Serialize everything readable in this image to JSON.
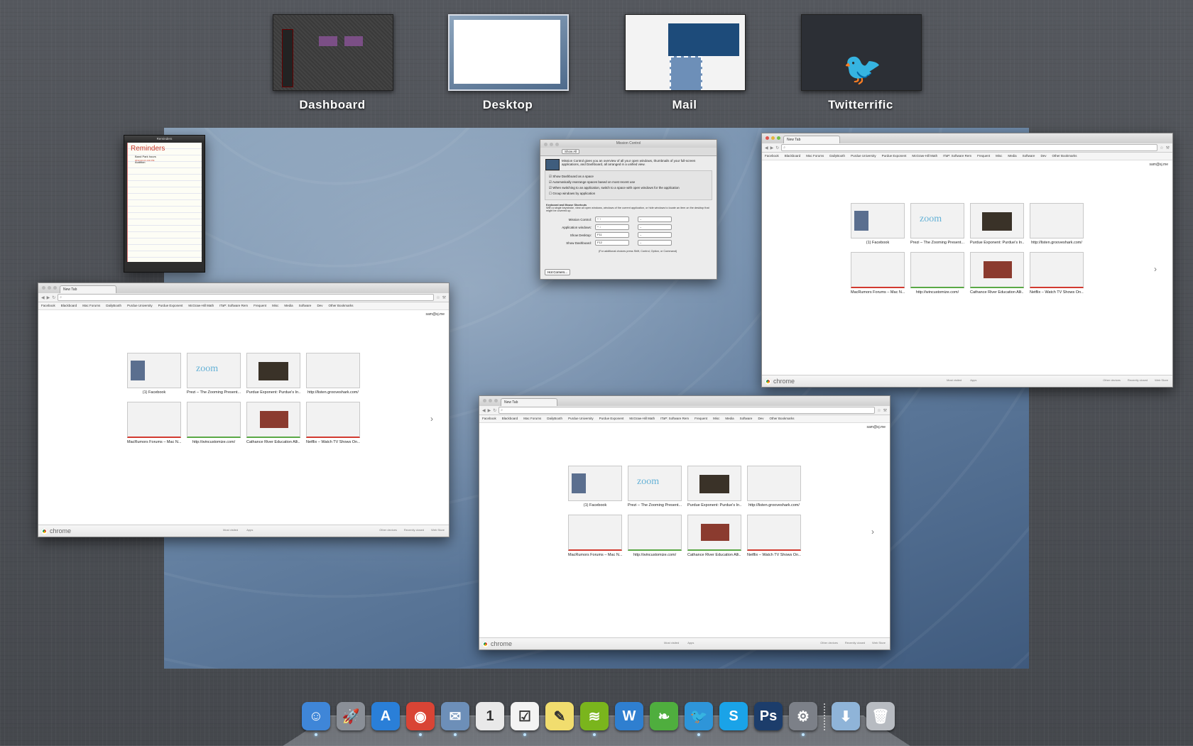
{
  "spaces": [
    {
      "label": "Dashboard"
    },
    {
      "label": "Desktop",
      "selected": true
    },
    {
      "label": "Mail"
    },
    {
      "label": "Twitterrific"
    }
  ],
  "reminders": {
    "window_title": "Reminders",
    "heading": "Reminders",
    "items": [
      {
        "text": "Band Park hours",
        "date": "2012-02-16 4:00 PM"
      },
      {
        "text": "Audition",
        "date": ""
      }
    ]
  },
  "mission_control": {
    "window_title": "Mission Control",
    "show_all": "Show All",
    "description": "Mission Control gives you an overview of all your open windows, thumbnails of your full-screen applications, and Dashboard, all arranged in a unified view.",
    "options": [
      {
        "text": "Show Dashboard as a space",
        "checked": true
      },
      {
        "text": "Automatically rearrange spaces based on most recent use",
        "checked": true
      },
      {
        "text": "When switching to an application, switch to a space with open windows for the application",
        "checked": true
      },
      {
        "text": "Group windows by application",
        "checked": false
      }
    ],
    "shortcuts_heading": "Keyboard and Mouse Shortcuts",
    "shortcuts_desc": "With a single keystroke, view all open windows, windows of the current application, or hide windows to locate an item on the desktop that might be covered up.",
    "shortcuts": [
      {
        "label": "Mission Control:",
        "key": "^ ↑",
        "mouse": "–"
      },
      {
        "label": "Application windows:",
        "key": "^ ↓",
        "mouse": "–"
      },
      {
        "label": "Show Desktop:",
        "key": "F11",
        "mouse": "–"
      },
      {
        "label": "Show Dashboard:",
        "key": "F12",
        "mouse": "–"
      }
    ],
    "footnote": "(For additional choices press Shift, Control, Option, or Command)",
    "hot_corners": "Hot Corners..."
  },
  "chrome": {
    "tab_title": "New Tab",
    "user": "sam@sj.me",
    "bookmarks": [
      "Facebook",
      "Blackboard",
      "Mac Forums",
      "DailyBooth",
      "Purdue University",
      "Purdue Exponent",
      "McGraw-Hill Math",
      "ITaP: Software Rem",
      "Frequent",
      "Misc",
      "Media",
      "Software",
      "Dev",
      "Other Bookmarks"
    ],
    "tiles": [
      {
        "caption": "(1) Facebook",
        "shot": "sh-fb",
        "bar": ""
      },
      {
        "caption": "Prezi – The Zooming Present...",
        "shot": "sh-prezi",
        "bar": ""
      },
      {
        "caption": "Purdue Exponent: Purdue's In...",
        "shot": "sh-purdue",
        "bar": ""
      },
      {
        "caption": "http://listen.grooveshark.com/",
        "shot": "",
        "bar": ""
      },
      {
        "caption": "MacRumors Forums – Mac N...",
        "shot": "sh-mac",
        "bar": "bar-red"
      },
      {
        "caption": "http://wincustomize.com/",
        "shot": "",
        "bar": "bar-green"
      },
      {
        "caption": "Cathance River Education Alli...",
        "shot": "sh-cath",
        "bar": "bar-green"
      },
      {
        "caption": "Netflix – Watch TV Shows On...",
        "shot": "",
        "bar": "bar-red"
      }
    ],
    "logo_text": "chrome",
    "footer_mid": [
      "Most visited",
      "Apps"
    ],
    "footer_right": [
      "Other devices",
      "Recently closed",
      "Web Store"
    ]
  },
  "dock": {
    "items": [
      {
        "name": "finder-icon",
        "glyph": "☺",
        "color": "#3f86d8",
        "running": true
      },
      {
        "name": "launchpad-icon",
        "glyph": "🚀",
        "color": "#8a8f97",
        "running": false
      },
      {
        "name": "app-store-icon",
        "glyph": "A",
        "color": "#2a7fd8",
        "running": false
      },
      {
        "name": "chrome-icon",
        "glyph": "◉",
        "color": "#d94435",
        "running": true
      },
      {
        "name": "mail-icon",
        "glyph": "✉",
        "color": "#6d8fb8",
        "running": true
      },
      {
        "name": "calendar-icon",
        "glyph": "1",
        "color": "#e9e9e9",
        "running": false
      },
      {
        "name": "reminders-icon",
        "glyph": "☑",
        "color": "#f3f3f3",
        "running": true
      },
      {
        "name": "stickies-icon",
        "glyph": "✎",
        "color": "#f1dd6e",
        "running": false
      },
      {
        "name": "spotify-icon",
        "glyph": "≋",
        "color": "#7ab51d",
        "running": true
      },
      {
        "name": "word-icon",
        "glyph": "W",
        "color": "#2f7fd0",
        "running": false
      },
      {
        "name": "leaf-icon",
        "glyph": "❧",
        "color": "#4fae3e",
        "running": false
      },
      {
        "name": "twitterrific-icon",
        "glyph": "🐦",
        "color": "#2e95d9",
        "running": true
      },
      {
        "name": "skype-icon",
        "glyph": "S",
        "color": "#1aa3e8",
        "running": false
      },
      {
        "name": "photoshop-icon",
        "glyph": "Ps",
        "color": "#1c3d6b",
        "running": false
      },
      {
        "name": "system-preferences-icon",
        "glyph": "⚙",
        "color": "#7c8088",
        "running": true
      },
      {
        "name": "downloads-folder-icon",
        "glyph": "⬇",
        "color": "#8fb4d8",
        "running": false
      },
      {
        "name": "trash-icon",
        "glyph": "🗑",
        "color": "#b7bbc1",
        "running": false
      }
    ]
  }
}
